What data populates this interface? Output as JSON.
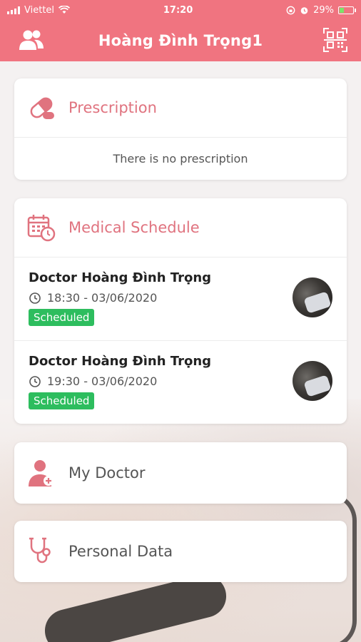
{
  "status_bar": {
    "carrier": "Viettel",
    "time": "17:20",
    "battery": "29%",
    "battery_level": 0.29
  },
  "header": {
    "title": "Hoàng Đình Trọng1",
    "left_icon": "users-icon",
    "right_icon": "qr-code-icon"
  },
  "prescription": {
    "title": "Prescription",
    "icon": "pill-icon",
    "empty_text": "There is no prescription"
  },
  "schedule": {
    "title": "Medical Schedule",
    "icon": "calendar-clock-icon",
    "appointments": [
      {
        "doctor": "Doctor Hoàng Đình Trọng",
        "time": "18:30 - 03/06/2020",
        "status": "Scheduled"
      },
      {
        "doctor": "Doctor Hoàng Đình Trọng",
        "time": "19:30 - 03/06/2020",
        "status": "Scheduled"
      }
    ]
  },
  "nav": {
    "my_doctor": "My Doctor",
    "personal_data": "Personal Data"
  },
  "colors": {
    "brand": "#f07480",
    "accent_text": "#e0737f",
    "status_scheduled": "#2dbd5e"
  }
}
